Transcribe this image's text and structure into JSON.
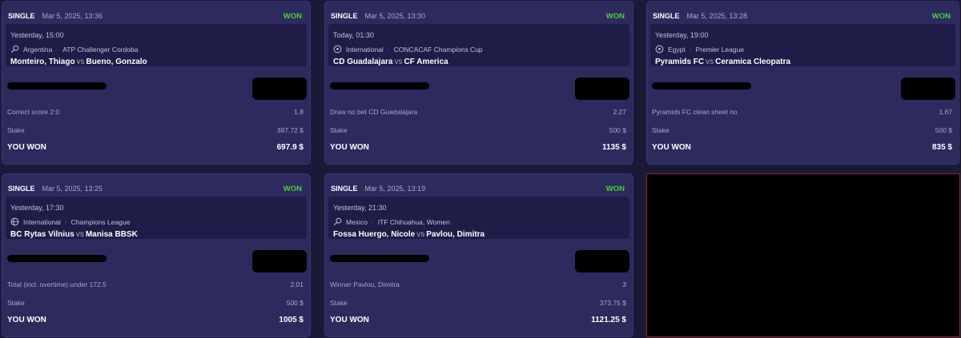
{
  "cards": [
    {
      "type": "SINGLE",
      "date": "Mar 5, 2025, 13:36",
      "status": "WON",
      "event_time": "Yesterday, 15:00",
      "sport_icon": "tennis-icon",
      "country": "Argentina",
      "league": "ATP Challenger Cordoba",
      "home": "Monteiro, Thiago",
      "vs": "vs",
      "away": "Bueno, Gonzalo",
      "selection": "Correct score 2:0",
      "odds": "1.8",
      "stake_label": "Stake",
      "stake": "387.72 $",
      "result_label": "YOU WON",
      "payout": "697.9 $"
    },
    {
      "type": "SINGLE",
      "date": "Mar 5, 2025, 13:30",
      "status": "WON",
      "event_time": "Today, 01:30",
      "sport_icon": "soccer-ball-icon",
      "country": "International",
      "league": "CONCACAF Champions Cup",
      "home": "CD Guadalajara",
      "vs": "vs",
      "away": "CF America",
      "selection": "Draw no bet CD Guadalajara",
      "odds": "2.27",
      "stake_label": "Stake",
      "stake": "500 $",
      "result_label": "YOU WON",
      "payout": "1135 $"
    },
    {
      "type": "SINGLE",
      "date": "Mar 5, 2025, 13:28",
      "status": "WON",
      "event_time": "Yesterday, 19:00",
      "sport_icon": "soccer-ball-icon",
      "country": "Egypt",
      "league": "Premier League",
      "home": "Pyramids FC",
      "vs": "vs",
      "away": "Ceramica Cleopatra",
      "selection": "Pyramids FC clean sheet no",
      "odds": "1.67",
      "stake_label": "Stake",
      "stake": "500 $",
      "result_label": "YOU WON",
      "payout": "835 $"
    },
    {
      "type": "SINGLE",
      "date": "Mar 5, 2025, 13:25",
      "status": "WON",
      "event_time": "Yesterday, 17:30",
      "sport_icon": "basketball-icon",
      "country": "International",
      "league": "Champions League",
      "home": "BC Rytas Vilnius",
      "vs": "vs",
      "away": "Manisa BBSK",
      "selection": "Total (incl. overtime) under 172.5",
      "odds": "2.01",
      "stake_label": "Stake",
      "stake": "500 $",
      "result_label": "YOU WON",
      "payout": "1005 $"
    },
    {
      "type": "SINGLE",
      "date": "Mar 5, 2025, 13:19",
      "status": "WON",
      "event_time": "Yesterday, 21:30",
      "sport_icon": "tennis-icon",
      "country": "Mexico",
      "league": "ITF Chihuahua, Women",
      "home": "Fossa Huergo, Nicole",
      "vs": "vs",
      "away": "Pavlou, Dimitra",
      "selection": "Winner Pavlou, Dimitra",
      "odds": "3",
      "stake_label": "Stake",
      "stake": "373.75 $",
      "result_label": "YOU WON",
      "payout": "1121.25 $"
    }
  ],
  "colors": {
    "background": "#1a1a38",
    "card": "#2d2a5e",
    "event_box": "#1f1c47",
    "won": "#48d03d",
    "muted_text": "#a9a7cc"
  }
}
